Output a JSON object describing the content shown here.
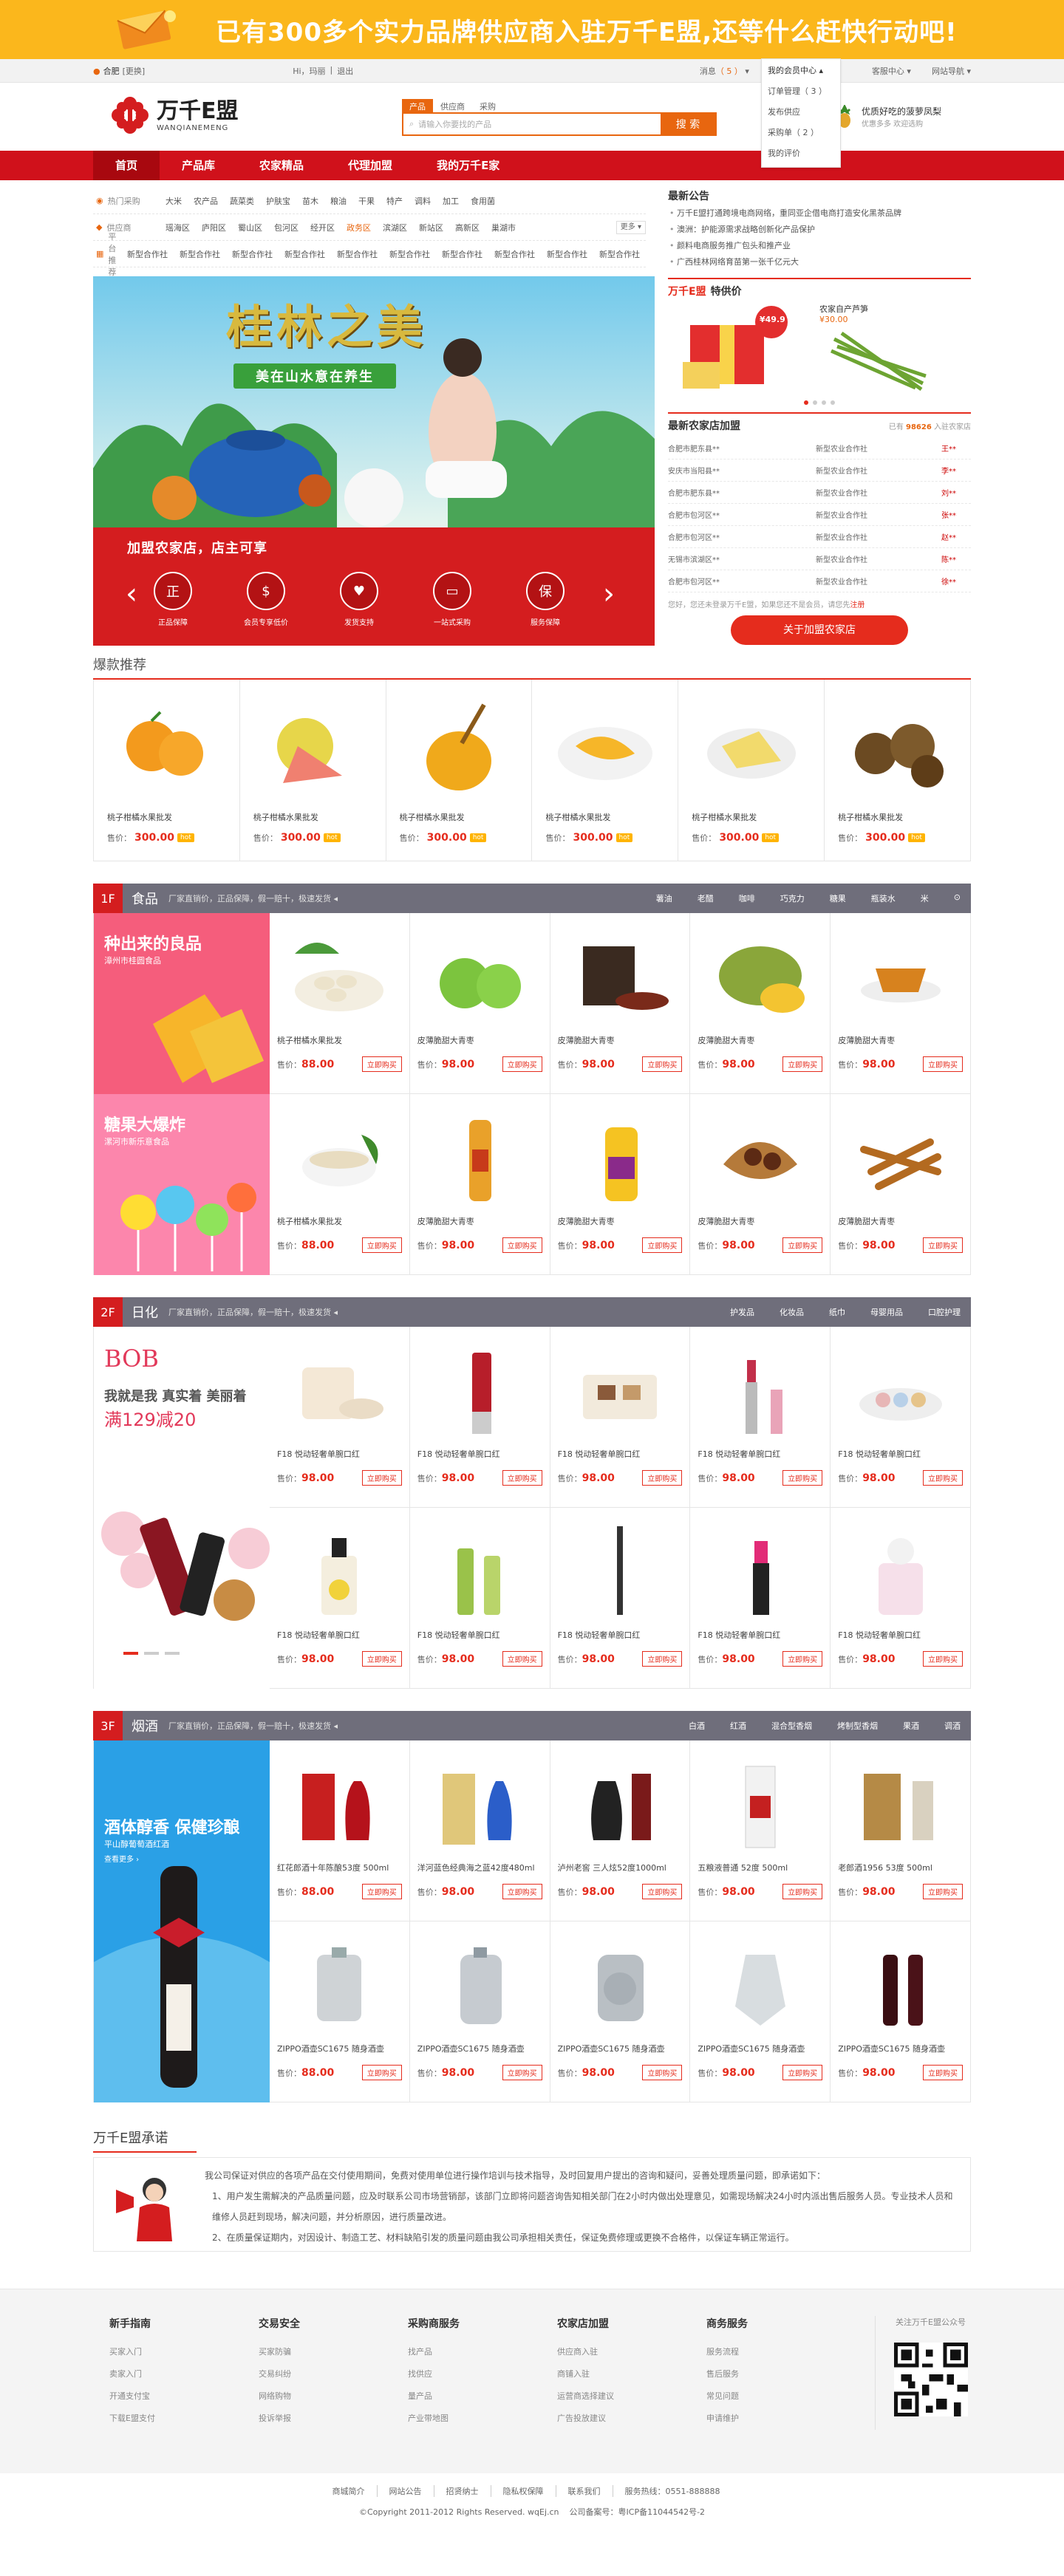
{
  "top_banner": {
    "text": "已有300多个实力品牌供应商入驻万千E盟,还等什么赶快行动吧!"
  },
  "topbar": {
    "city": "合肥",
    "city_switch": "[更换]",
    "greeting": "Hi，玛丽",
    "separator": "|",
    "logout": "退出",
    "messages_label": "消息",
    "messages_count": "（ 5 ）",
    "member_center": "我的会员中心",
    "service": "客服中心",
    "sitemap": "网站导航"
  },
  "member_dropdown": {
    "title": "我的会员中心",
    "items": [
      "订单管理（ 3 ）",
      "发布供应",
      "采购单（ 2 ）",
      "我的评价"
    ]
  },
  "header": {
    "logo_name": "万千E盟",
    "logo_pinyin": "WANQIANEMENG",
    "search_tabs": [
      "产品",
      "供应商",
      "采购"
    ],
    "search_placeholder": "请输入你要找的产品",
    "search_button": "搜 索",
    "promo_title": "优质好吃的菠萝凤梨",
    "promo_sub": "优惠多多 欢迎选购"
  },
  "nav": {
    "items": [
      "首页",
      "产品库",
      "农家精品",
      "代理加盟",
      "我的万千E家"
    ]
  },
  "categories": [
    {
      "label": "热门采购",
      "items": [
        "大米",
        "农产品",
        "蔬菜类",
        "护肤宝",
        "苗木",
        "粮油",
        "干果",
        "特产",
        "调料",
        "加工",
        "食用菌"
      ],
      "more": ""
    },
    {
      "label": "供应商",
      "items": [
        "瑶海区",
        "庐阳区",
        "蜀山区",
        "包河区",
        "经开区",
        "政务区",
        "滨湖区",
        "新站区",
        "高新区",
        "巢湖市"
      ],
      "more": "更多 ▾"
    },
    {
      "label": "平台推荐",
      "items": [
        "新型合作社",
        "新型合作社",
        "新型合作社",
        "新型合作社",
        "新型合作社",
        "新型合作社",
        "新型合作社",
        "新型合作社",
        "新型合作社",
        "新型合作社"
      ],
      "more": ""
    }
  ],
  "hero": {
    "banner_title": "桂林之美",
    "banner_sub": "美在山水意在养生",
    "join_text": "加盟农家店，店主可享",
    "icons": [
      {
        "glyph": "正",
        "label": "正品保障"
      },
      {
        "glyph": "$",
        "label": "会员专享低价"
      },
      {
        "glyph": "♥",
        "label": "发货支持"
      },
      {
        "glyph": "▭",
        "label": "一站式采购"
      },
      {
        "glyph": "保",
        "label": "服务保障"
      }
    ],
    "prev": "‹",
    "next": "›"
  },
  "announcements": {
    "title": "最新公告",
    "items": [
      "万千E盟打通跨境电商网络，重同亚企借电商打造安化黑茶品牌",
      "澳洲：护能源需求战略创新化产品保护",
      "颜料电商服务推广包头和推产业",
      "广西桂林网络育苗第一张千亿元大"
    ]
  },
  "special": {
    "brand": "万千E盟",
    "title": "特供价",
    "products": [
      {
        "price_tag": "¥49.9",
        "name": ""
      },
      {
        "price_tag": "¥30.00",
        "name": "农家自产芦笋"
      }
    ]
  },
  "new_stores": {
    "title": "最新农家店加盟",
    "count_prefix": "已有",
    "count": "98626",
    "count_suffix": "入驻农家店",
    "rows": [
      [
        "合肥市肥东县**",
        "新型农业合作社",
        "王**"
      ],
      [
        "安庆市当阳县**",
        "新型农业合作社",
        "李**"
      ],
      [
        "合肥市肥东县**",
        "新型农业合作社",
        "刘**"
      ],
      [
        "合肥市包河区**",
        "新型农业合作社",
        "张**"
      ],
      [
        "合肥市包河区**",
        "新型农业合作社",
        "赵**"
      ],
      [
        "无锡市滨湖区**",
        "新型农业合作社",
        "陈**"
      ],
      [
        "合肥市包河区**",
        "新型农业合作社",
        "徐**"
      ]
    ],
    "hint": "您好，您还未登录万千E盟，如果您还不是会员，请您先",
    "hint_link": "注册",
    "join_button": "关于加盟农家店"
  },
  "hot": {
    "title": "爆款推荐",
    "price_label": "售价：",
    "hot_tag": "hot",
    "products": [
      {
        "name": "桃子柑橘水果批发",
        "price": "300.00",
        "img": "orange"
      },
      {
        "name": "桃子柑橘水果批发",
        "price": "300.00",
        "img": "pomelo"
      },
      {
        "name": "桃子柑橘水果批发",
        "price": "300.00",
        "img": "honey"
      },
      {
        "name": "桃子柑橘水果批发",
        "price": "300.00",
        "img": "mango"
      },
      {
        "name": "桃子柑橘水果批发",
        "price": "300.00",
        "img": "durian"
      },
      {
        "name": "桃子柑橘水果批发",
        "price": "300.00",
        "img": "nut"
      }
    ]
  },
  "floors": [
    {
      "num": "1F",
      "title": "食品",
      "sub": "厂家直销价，正品保障，假一赔十，极速发货 ◂",
      "tabs": [
        "薯油",
        "老醋",
        "咖啡",
        "巧克力",
        "糖果",
        "瓶装水",
        "米",
        "⊙"
      ],
      "ads": [
        {
          "title": "种出来的良品",
          "sub": "漳州市桂圆食品",
          "theme": "mango"
        },
        {
          "title": "糖果大爆炸",
          "sub": "漯河市新乐意食品",
          "theme": "candy"
        }
      ],
      "buy": "立即购买",
      "price_label": "售价：",
      "products": [
        {
          "name": "桃子柑橘水果批发",
          "price": "88.00",
          "img": "nuts"
        },
        {
          "name": "皮薄脆甜大青枣",
          "price": "98.00",
          "img": "apple"
        },
        {
          "name": "皮薄脆甜大青枣",
          "price": "98.00",
          "img": "tea"
        },
        {
          "name": "皮薄脆甜大青枣",
          "price": "98.00",
          "img": "jackfruit"
        },
        {
          "name": "皮薄脆甜大青枣",
          "price": "98.00",
          "img": "teacup"
        },
        {
          "name": "桃子柑橘水果批发",
          "price": "88.00",
          "img": "bowl"
        },
        {
          "name": "皮薄脆甜大青枣",
          "price": "98.00",
          "img": "oil"
        },
        {
          "name": "皮薄脆甜大青枣",
          "price": "98.00",
          "img": "oil2"
        },
        {
          "name": "皮薄脆甜大青枣",
          "price": "98.00",
          "img": "dates"
        },
        {
          "name": "皮薄脆甜大青枣",
          "price": "98.00",
          "img": "sticks"
        }
      ]
    },
    {
      "num": "2F",
      "title": "日化",
      "sub": "厂家直销价，正品保障，假一赔十，极速发货 ◂",
      "tabs": [
        "护发品",
        "化妆品",
        "纸巾",
        "母婴用品",
        "口腔护理"
      ],
      "ads": [
        {
          "title": "我就是我 真实着 美丽着",
          "sub": "满129减20",
          "brand": "BOB",
          "theme": "bob"
        }
      ],
      "buy": "立即购买",
      "price_label": "售价：",
      "products": [
        {
          "name": "F18 悦动轻奢单腕口红",
          "price": "98.00",
          "img": "powder"
        },
        {
          "name": "F18 悦动轻奢单腕口红",
          "price": "98.00",
          "img": "tube"
        },
        {
          "name": "F18 悦动轻奢单腕口红",
          "price": "98.00",
          "img": "palette"
        },
        {
          "name": "F18 悦动轻奢单腕口红",
          "price": "98.00",
          "img": "lipstick"
        },
        {
          "name": "F18 悦动轻奢单腕口红",
          "price": "98.00",
          "img": "eyeshadow"
        },
        {
          "name": "F18 悦动轻奢单腕口红",
          "price": "98.00",
          "img": "perfume"
        },
        {
          "name": "F18 悦动轻奢单腕口红",
          "price": "98.00",
          "img": "bottles"
        },
        {
          "name": "F18 悦动轻奢单腕口红",
          "price": "98.00",
          "img": "pencil"
        },
        {
          "name": "F18 悦动轻奢单腕口红",
          "price": "98.00",
          "img": "lipstick2"
        },
        {
          "name": "F18 悦动轻奢单腕口红",
          "price": "98.00",
          "img": "perfume2"
        }
      ]
    },
    {
      "num": "3F",
      "title": "烟酒",
      "sub": "厂家直销价，正品保障，假一赔十，极速发货 ◂",
      "tabs": [
        "白酒",
        "红酒",
        "混合型香烟",
        "烤制型香烟",
        "果酒",
        "调酒"
      ],
      "ads": [
        {
          "title": "酒体醇香 保健珍酿",
          "sub": "平山醇葡萄酒红酒",
          "link": "查看更多 ›",
          "theme": "wine"
        }
      ],
      "buy": "立即购买",
      "price_label": "售价：",
      "products": [
        {
          "name": "红花郎酒十年陈酿53度 500ml",
          "price": "88.00",
          "img": "langjiu"
        },
        {
          "name": "洋河蓝色经典海之蓝42度480ml",
          "price": "98.00",
          "img": "yanghe"
        },
        {
          "name": "泸州老窖 三人炫52度1000ml",
          "price": "98.00",
          "img": "luzhou"
        },
        {
          "name": "五粮液普通 52度 500ml",
          "price": "98.00",
          "img": "wuliang"
        },
        {
          "name": "老郎酒1956 53度 500ml",
          "price": "98.00",
          "img": "laolang"
        },
        {
          "name": "ZIPPO酒壶SC1675 随身酒壶",
          "price": "88.00",
          "img": "flask"
        },
        {
          "name": "ZIPPO酒壶SC1675 随身酒壶",
          "price": "98.00",
          "img": "flask2"
        },
        {
          "name": "ZIPPO酒壶SC1675 随身酒壶",
          "price": "98.00",
          "img": "flask3"
        },
        {
          "name": "ZIPPO酒壶SC1675 随身酒壶",
          "price": "98.00",
          "img": "flask4"
        },
        {
          "name": "ZIPPO酒壶SC1675 随身酒壶",
          "price": "98.00",
          "img": "redwine"
        }
      ]
    }
  ],
  "promise": {
    "title": "万千E盟承诺",
    "lines": [
      "我公司保证对供应的各项产品在交付使用期间，免费对使用单位进行操作培训与技术指导，及时回复用户提出的咨询和疑问，妥善处理质量问题，即承诺如下：",
      "1、用户发生需解决的产品质量问题，应及时联系公司市场营销部，该部门立即将问题咨询告知相关部门在2小时内做出处理意见，如需现场解决24小时内派出售后服务人员。专业技术人员和维修人员赶到现场，解决问题，并分析原因，进行质量改进。",
      "2、在质量保证期内，对因设计、制造工艺、材料缺陷引发的质量问题由我公司承担相关责任，保证免费修理或更换不合格件，以保证车辆正常运行。"
    ]
  },
  "footer": {
    "cols": [
      {
        "title": "新手指南",
        "items": [
          "买家入门",
          "卖家入门",
          "开通支付宝",
          "下载E盟支付"
        ]
      },
      {
        "title": "交易安全",
        "items": [
          "买家防骗",
          "交易纠纷",
          "网络购物",
          "投诉举报"
        ]
      },
      {
        "title": "采购商服务",
        "items": [
          "找产品",
          "找供应",
          "量产品",
          "产业带地图"
        ]
      },
      {
        "title": "农家店加盟",
        "items": [
          "供应商入驻",
          "商铺入驻",
          "运营商选择建议",
          "广告投放建议"
        ]
      },
      {
        "title": "商务服务",
        "items": [
          "服务流程",
          "售后服务",
          "常见问题",
          "申请维护"
        ]
      }
    ],
    "qr_title": "关注万千E盟公众号"
  },
  "bottom": {
    "links": [
      "商城简介",
      "网站公告",
      "招贤纳士",
      "隐私权保障",
      "联系我们",
      "服务热线：0551-888888"
    ],
    "copyright": "©Copyright 2011-2012 Rights Reserved. wqEj.cn",
    "icp": "公司备案号：粤ICP备11044542号-2"
  }
}
